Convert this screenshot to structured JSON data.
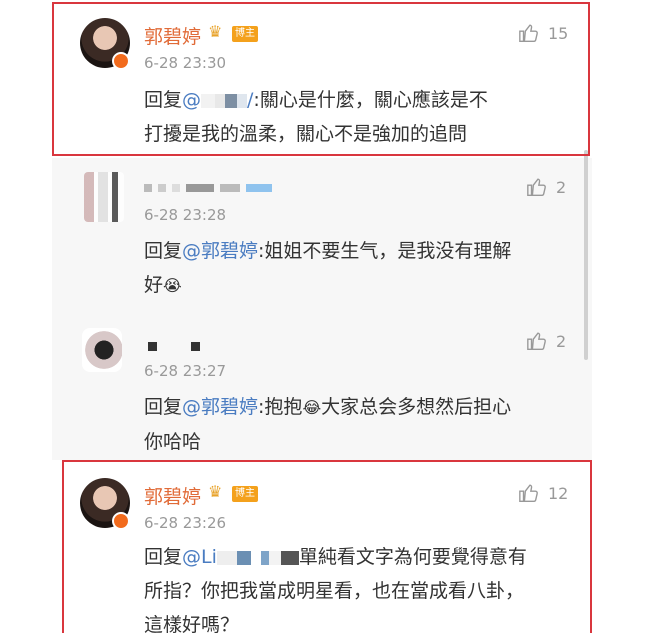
{
  "comments": [
    {
      "name": "郭碧婷",
      "badge": "博主",
      "time": "6-28 23:30",
      "reply_prefix": "回复",
      "mention": "@",
      "mention_tail": "/",
      "body_line1": ":關心是什麼，關心應該是不",
      "body_line2": "打擾是我的溫柔，關心不是強加的追問",
      "likes": "15"
    },
    {
      "time": "6-28 23:28",
      "reply_prefix": "回复",
      "mention": "@郭碧婷",
      "body_line1": ":姐姐不要生气，是我没有理解",
      "body_line2": "好",
      "likes": "2"
    },
    {
      "time": "6-28 23:27",
      "reply_prefix": "回复",
      "mention": "@郭碧婷",
      "body_line1": ":抱抱",
      "body_line1b": "大家总会多想然后担心",
      "body_line2": "你哈哈",
      "likes": "2"
    },
    {
      "name": "郭碧婷",
      "badge": "博主",
      "time": "6-28 23:26",
      "reply_prefix": "回复",
      "mention": "@Li",
      "body_line1": "單純看文字為何要覺得意有",
      "body_line2": "所指？你把我當成明星看，也在當成看八卦，",
      "body_line3": "這樣好嗎？",
      "likes": "12"
    }
  ],
  "icons": {
    "like": "thumbs-up-icon",
    "crown": "crown-icon",
    "vip": "verified-icon",
    "emoji_crying": "crying-emoji-icon",
    "emoji_laugh": "laughing-emoji-icon"
  },
  "colors": {
    "name": "#e16b38",
    "mention": "#4a7cc1",
    "highlight_border": "#d9363e",
    "meta": "#999999"
  }
}
